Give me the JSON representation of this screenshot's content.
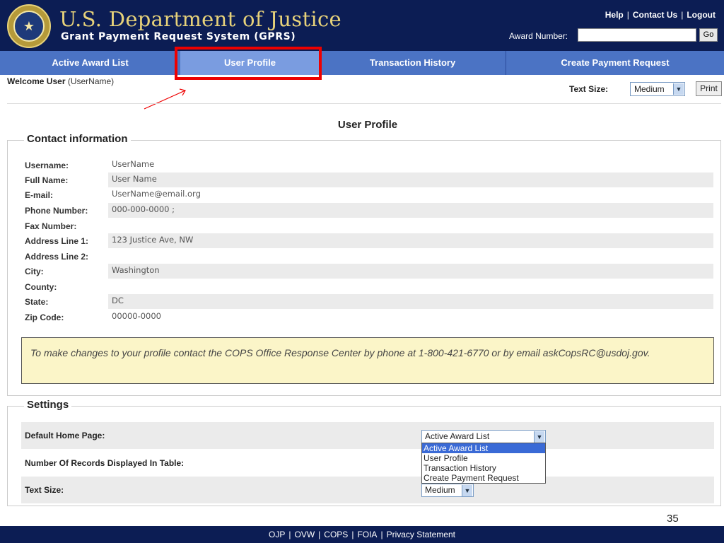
{
  "header": {
    "title": "U.S. Department of Justice",
    "subtitle": "Grant Payment Request System (GPRS)",
    "links": [
      "Help",
      "Contact Us",
      "Logout"
    ],
    "award_label": "Award Number:",
    "award_value": "",
    "go_label": "Go"
  },
  "nav": {
    "tabs": [
      "Active Award List",
      "User Profile",
      "Transaction History",
      "Create Payment Request"
    ],
    "selected": "User Profile"
  },
  "welcome": {
    "label": "Welcome User",
    "username": "(UserName)"
  },
  "text_size": {
    "label": "Text Size:",
    "value": "Medium",
    "print_label": "Print"
  },
  "page_title": "User Profile",
  "contact": {
    "legend": "Contact information",
    "fields": [
      {
        "label": "Username:",
        "value": "UserName"
      },
      {
        "label": "Full Name:",
        "value": "User Name"
      },
      {
        "label": "E-mail:",
        "value": "UserName@email.org"
      },
      {
        "label": "Phone Number:",
        "value": "000-000-0000  ;"
      },
      {
        "label": "Fax Number:",
        "value": ""
      },
      {
        "label": "Address Line 1:",
        "value": "123 Justice Ave, NW"
      },
      {
        "label": "Address Line 2:",
        "value": ""
      },
      {
        "label": "City:",
        "value": "Washington"
      },
      {
        "label": "County:",
        "value": ""
      },
      {
        "label": "State:",
        "value": "DC"
      },
      {
        "label": "Zip Code:",
        "value": "00000-0000"
      }
    ],
    "notice": "To make changes to your profile contact the COPS Office Response Center by phone at 1-800-421-6770 or by email askCopsRC@usdoj.gov."
  },
  "settings": {
    "legend": "Settings",
    "default_home_label": "Default Home Page:",
    "default_home_value": "Active Award List",
    "default_home_options": [
      "Active Award List",
      "User Profile",
      "Transaction History",
      "Create Payment Request"
    ],
    "records_label": "Number Of Records Displayed In Table:",
    "text_size_label": "Text Size:",
    "text_size_value": "Medium"
  },
  "page_number": "35",
  "footer": {
    "links": [
      "OJP",
      "OVW",
      "COPS",
      "FOIA",
      "Privacy Statement"
    ]
  },
  "colors": {
    "header_bg": "#0c1d54",
    "nav_bg": "#4b73c4",
    "nav_selected_bg": "#7a9ce0",
    "title_gold": "#e7d27a",
    "highlight_red": "#e00000",
    "notice_bg": "#fbf5c8",
    "list_selected": "#3a6ad6"
  },
  "icons": [
    "doj-seal-icon",
    "chevron-down-icon",
    "annotation-arrow-icon"
  ]
}
